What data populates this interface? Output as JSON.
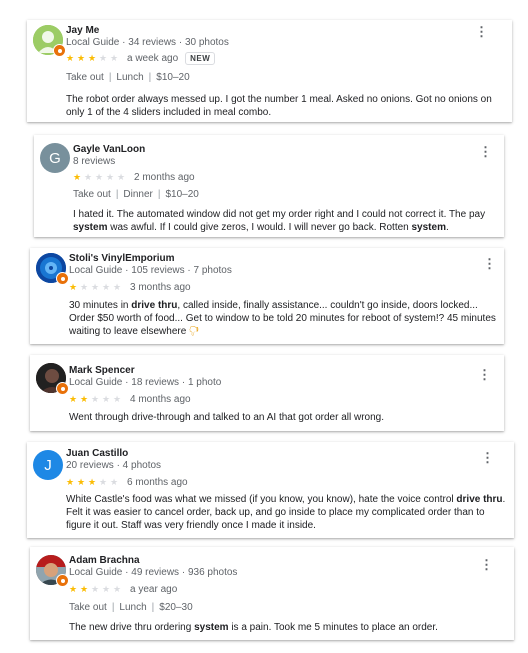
{
  "reviews": [
    {
      "name": "Jay Me",
      "meta": "Local Guide · 34 reviews · 30 photos",
      "rating": 3,
      "time": "a week ago",
      "new_label": "NEW",
      "tags": [
        "Take out",
        "Lunch",
        "$10–20"
      ],
      "text": "The robot order always messed up. I got the number 1 meal. Asked no onions. Got no onions on only 1 of the 4 sliders included in meal combo.",
      "avatar_color": "#8bc34a"
    },
    {
      "name": "Gayle VanLoon",
      "meta": "8 reviews",
      "rating": 1,
      "time": "2 months ago",
      "tags": [
        "Take out",
        "Dinner",
        "$10–20"
      ],
      "text_parts": [
        "I hated it. The automated window did not get my order right and I could not correct it. The pay ",
        "system",
        " was awful. If I could give zeros, I would. I will never go back. Rotten ",
        "system",
        "."
      ],
      "avatar_letter": "G",
      "avatar_color": "#78909c"
    },
    {
      "name": "Stoli's VinylEmporium",
      "meta": "Local Guide · 105 reviews · 7 photos",
      "rating": 1,
      "time": "3 months ago",
      "text_parts": [
        "30 minutes in ",
        "drive thru",
        ", called inside, finally assistance... couldn't go inside, doors locked... Order $50 worth of food... Get to window to be told 20 minutes for reboot of system!? 45 minutes waiting to leave elsewhere"
      ],
      "emoji": "🖓",
      "avatar_color": "#1565c0"
    },
    {
      "name": "Mark Spencer",
      "meta": "Local Guide · 18 reviews · 1 photo",
      "rating": 2,
      "time": "4 months ago",
      "text": "Went through drive-through and talked to an AI that got order all wrong.",
      "avatar_color": "#3e2723"
    },
    {
      "name": "Juan Castillo",
      "meta": "20 reviews · 4 photos",
      "rating": 3,
      "time": "6 months ago",
      "text_parts": [
        "White Castle's food was what we missed (if you know, you know), hate the voice control ",
        "drive thru",
        ".  Felt it was easier to cancel order, back up, and go inside to place my complicated order than to figure it out. Staff was very friendly once I made it inside."
      ],
      "avatar_letter": "J",
      "avatar_color": "#1e88e5"
    },
    {
      "name": "Adam Brachna",
      "meta": "Local Guide · 49 reviews · 936 photos",
      "rating": 2,
      "time": "a year ago",
      "tags": [
        "Take out",
        "Lunch",
        "$20–30"
      ],
      "text_parts": [
        "The new drive thru ordering ",
        "system",
        " is a pain. Took me 5 minutes to place an order."
      ],
      "avatar_color": "#6d4c41"
    }
  ]
}
